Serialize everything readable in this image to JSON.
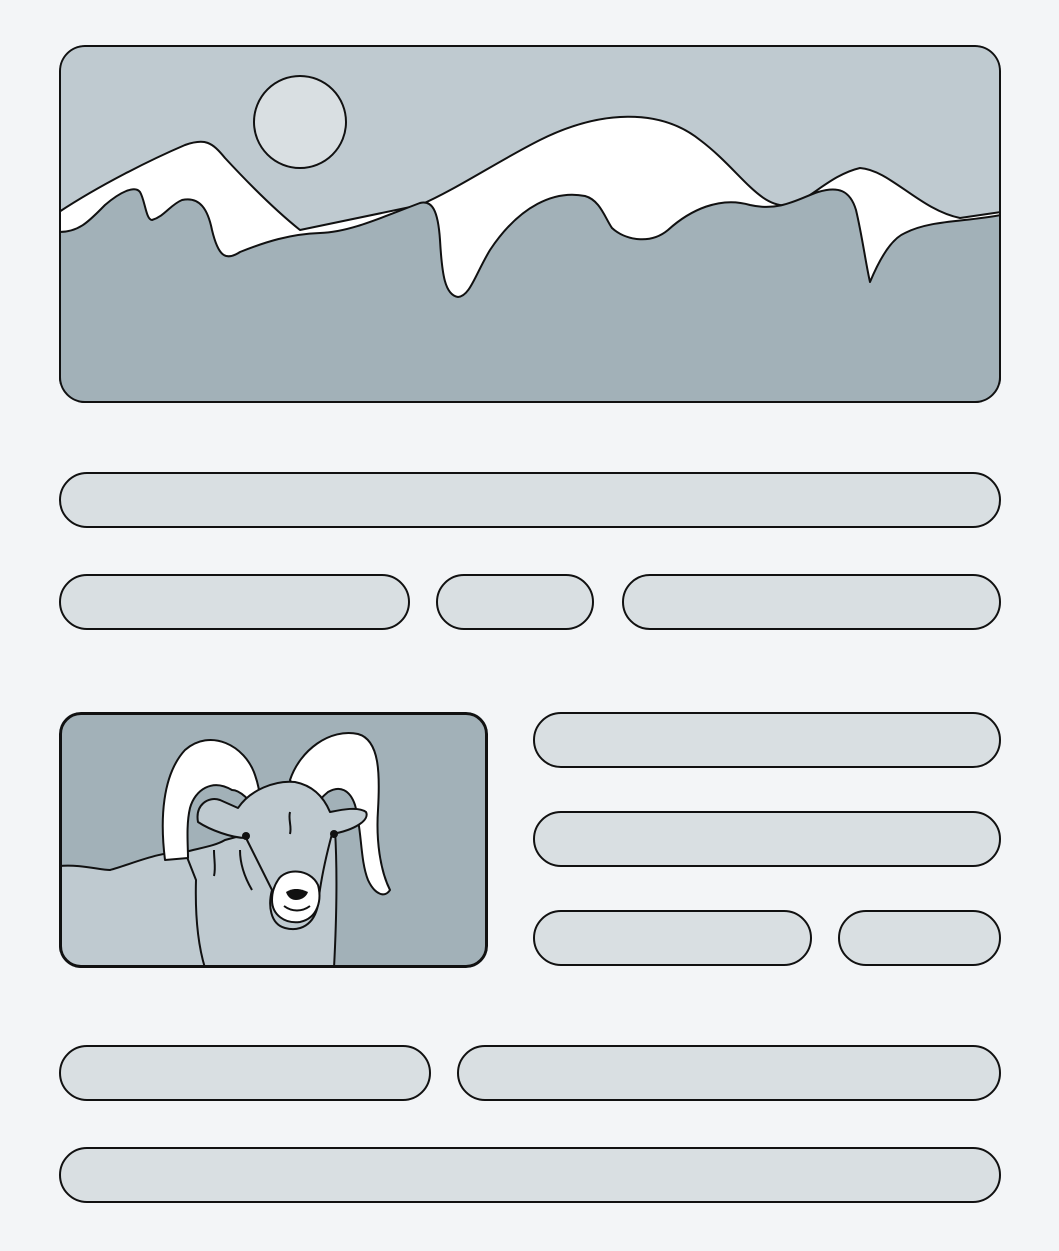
{
  "colors": {
    "background": "#f3f5f7",
    "sky": "#bfcad0",
    "ground": "#a2b1b8",
    "snow": "#ffffff",
    "sun": "#d9dfe2",
    "placeholder_bar": "#d9dfe2",
    "outline": "#111111"
  },
  "hero_image": {
    "icon": "mountain-landscape-icon"
  },
  "thumbnail_image": {
    "icon": "bighorn-ram-icon"
  },
  "text_placeholders": {
    "hero_caption_lines": 2,
    "side_lines": 3,
    "footer_lines": 2
  }
}
